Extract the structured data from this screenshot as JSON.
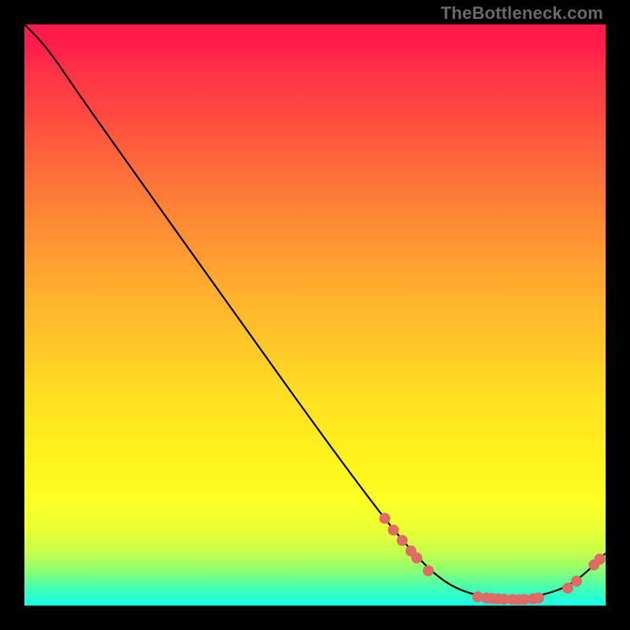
{
  "watermark": "TheBottleneck.com",
  "chart_data": {
    "type": "line",
    "title": "",
    "xlabel": "",
    "ylabel": "",
    "xlim": [
      0,
      100
    ],
    "ylim": [
      0,
      100
    ],
    "curve": [
      {
        "x": 0,
        "y": 100
      },
      {
        "x": 3,
        "y": 97
      },
      {
        "x": 6,
        "y": 93
      },
      {
        "x": 9,
        "y": 88.5
      },
      {
        "x": 20,
        "y": 73
      },
      {
        "x": 35,
        "y": 52
      },
      {
        "x": 50,
        "y": 31
      },
      {
        "x": 60,
        "y": 17.5
      },
      {
        "x": 66,
        "y": 10
      },
      {
        "x": 72,
        "y": 4
      },
      {
        "x": 78,
        "y": 1.5
      },
      {
        "x": 85,
        "y": 1
      },
      {
        "x": 92,
        "y": 2.5
      },
      {
        "x": 96,
        "y": 5
      },
      {
        "x": 100,
        "y": 9
      }
    ],
    "marker_clusters": [
      {
        "name": "descent-cluster",
        "points": [
          {
            "x": 62,
            "y": 15
          },
          {
            "x": 63.5,
            "y": 13
          },
          {
            "x": 65,
            "y": 11.2
          },
          {
            "x": 66.5,
            "y": 9.4
          },
          {
            "x": 67.5,
            "y": 8.2
          },
          {
            "x": 69.5,
            "y": 6
          }
        ]
      },
      {
        "name": "trough-cluster",
        "points": [
          {
            "x": 78,
            "y": 1.5
          },
          {
            "x": 79.5,
            "y": 1.3
          },
          {
            "x": 80.5,
            "y": 1.2
          },
          {
            "x": 81.5,
            "y": 1.15
          },
          {
            "x": 82.5,
            "y": 1.1
          },
          {
            "x": 84,
            "y": 1.05
          },
          {
            "x": 85,
            "y": 1.0
          },
          {
            "x": 86,
            "y": 1.05
          },
          {
            "x": 87.5,
            "y": 1.15
          },
          {
            "x": 88.5,
            "y": 1.3
          }
        ]
      },
      {
        "name": "upturn-cluster",
        "points": [
          {
            "x": 93.5,
            "y": 3
          },
          {
            "x": 95,
            "y": 4.2
          },
          {
            "x": 98,
            "y": 7
          },
          {
            "x": 99,
            "y": 8
          }
        ]
      }
    ],
    "background_gradient": {
      "top": "#ff1a4a",
      "bottom": "#14ffeb",
      "description": "vertical red→orange→yellow→green→teal"
    }
  }
}
